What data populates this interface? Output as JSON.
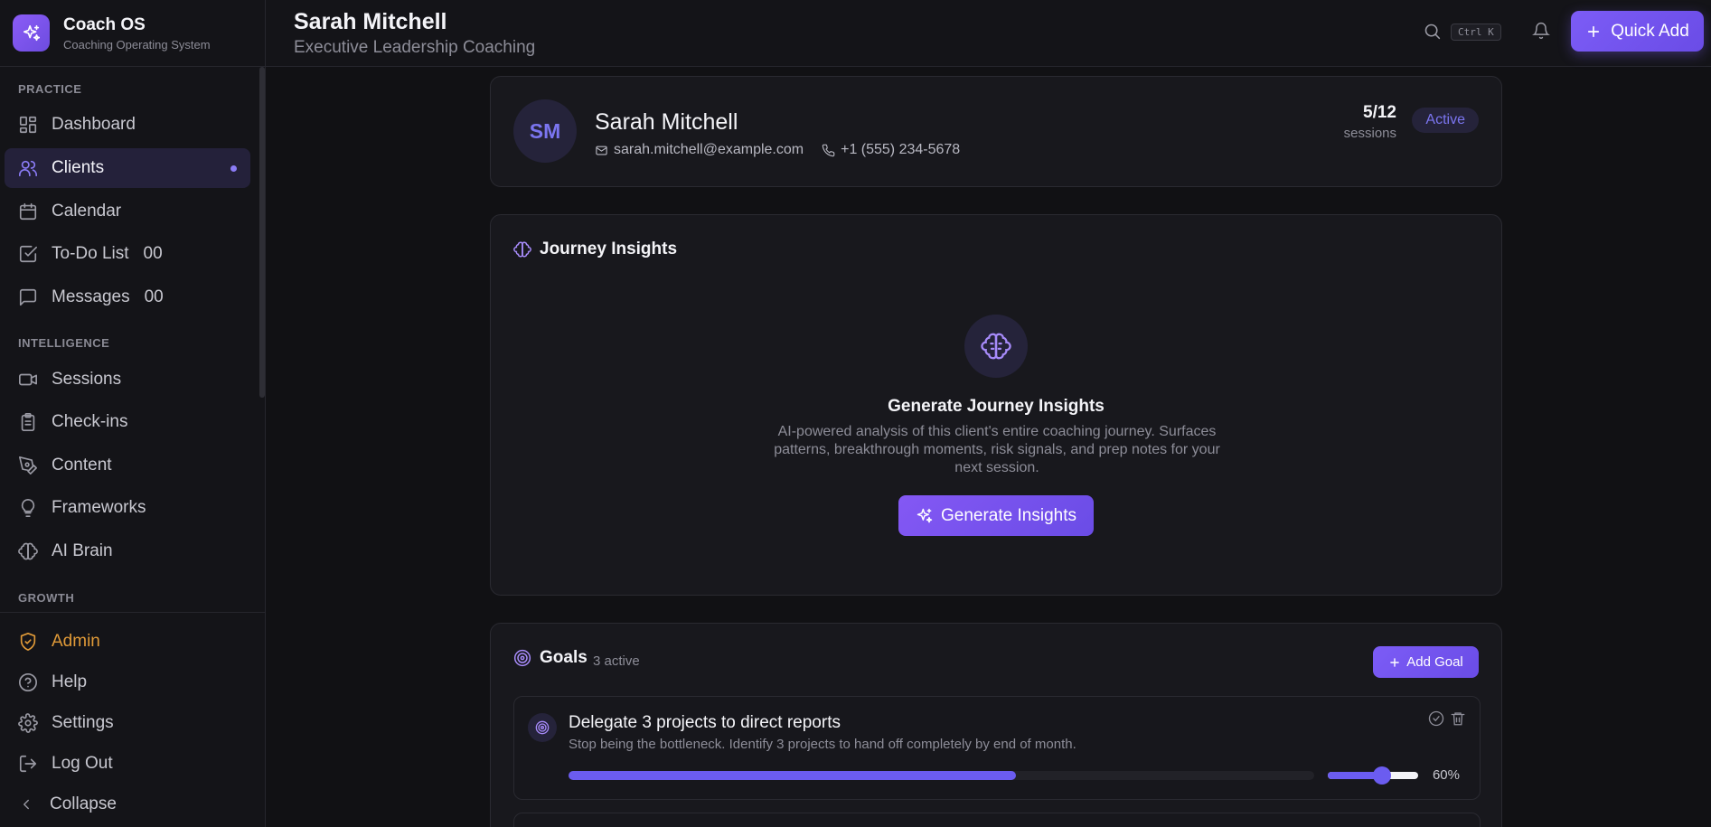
{
  "brand": {
    "name": "Coach OS",
    "tagline": "Coaching Operating System"
  },
  "sidebar": {
    "sections": [
      "PRACTICE",
      "INTELLIGENCE",
      "GROWTH"
    ],
    "practice": [
      {
        "label": "Dashboard",
        "icon": "dashboard-icon"
      },
      {
        "label": "Clients",
        "icon": "users-icon",
        "active": true
      },
      {
        "label": "Calendar",
        "icon": "calendar-icon"
      },
      {
        "label": "To-Do List",
        "icon": "checkbox-icon",
        "count": "00"
      },
      {
        "label": "Messages",
        "icon": "message-icon",
        "count": "00"
      }
    ],
    "intelligence": [
      {
        "label": "Sessions",
        "icon": "video-icon"
      },
      {
        "label": "Check-ins",
        "icon": "clipboard-icon"
      },
      {
        "label": "Content",
        "icon": "pen-tool-icon"
      },
      {
        "label": "Frameworks",
        "icon": "lightbulb-icon"
      },
      {
        "label": "AI Brain",
        "icon": "brain-icon"
      }
    ],
    "bottom": [
      {
        "label": "Admin",
        "icon": "shield-icon"
      },
      {
        "label": "Help",
        "icon": "help-icon"
      },
      {
        "label": "Settings",
        "icon": "gear-icon"
      },
      {
        "label": "Log Out",
        "icon": "logout-icon"
      },
      {
        "label": "Collapse",
        "icon": "chevron-left-icon"
      }
    ]
  },
  "header": {
    "title": "Sarah Mitchell",
    "subtitle": "Executive Leadership Coaching",
    "shortcut": "Ctrl K",
    "quick_add": "Quick Add"
  },
  "profile": {
    "initials": "SM",
    "name": "Sarah Mitchell",
    "email": "sarah.mitchell@example.com",
    "phone": "+1 (555) 234-5678",
    "sessions_count": "5/12",
    "sessions_label": "sessions",
    "status": "Active"
  },
  "insights": {
    "title": "Journey Insights",
    "heading": "Generate Journey Insights",
    "description": "AI-powered analysis of this client's entire coaching journey. Surfaces patterns, breakthrough moments, risk signals, and prep notes for your next session.",
    "button": "Generate Insights"
  },
  "goals": {
    "title": "Goals",
    "count_label": "3 active",
    "add_button": "Add Goal",
    "items": [
      {
        "title": "Delegate 3 projects to direct reports",
        "description": "Stop being the bottleneck. Identify 3 projects to hand off completely by end of month.",
        "progress": 60,
        "progress_label": "60%"
      }
    ]
  },
  "colors": {
    "accent": "#7c5cf6",
    "admin": "#e09a38",
    "background": "#111114"
  }
}
